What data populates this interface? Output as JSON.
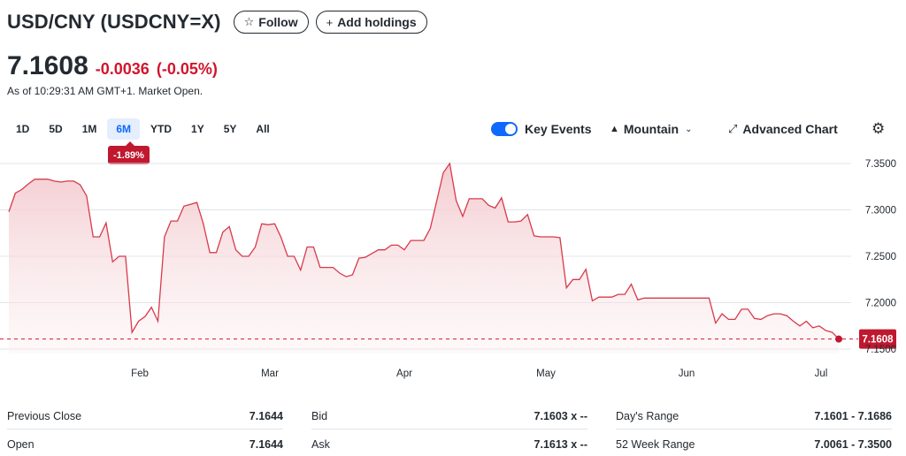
{
  "header": {
    "title": "USD/CNY (USDCNY=X)",
    "follow_label": "Follow",
    "add_holdings_label": "Add holdings"
  },
  "quote": {
    "price": "7.1608",
    "change": "-0.0036",
    "change_pct": "(-0.05%)",
    "as_of": "As of 10:29:31 AM GMT+1. Market Open."
  },
  "range_tabs": [
    {
      "label": "1D",
      "active": false
    },
    {
      "label": "5D",
      "active": false
    },
    {
      "label": "1M",
      "active": false
    },
    {
      "label": "6M",
      "active": true
    },
    {
      "label": "YTD",
      "active": false
    },
    {
      "label": "1Y",
      "active": false
    },
    {
      "label": "5Y",
      "active": false
    },
    {
      "label": "All",
      "active": false
    }
  ],
  "range_badge": "-1.89%",
  "tools": {
    "key_events_label": "Key Events",
    "key_events_on": true,
    "chart_type_label": "Mountain",
    "advanced_chart_label": "Advanced Chart"
  },
  "colors": {
    "line": "#d83a4a",
    "fill_top": "#f6d6d9",
    "down": "#d0162c",
    "accent": "#0f69ff"
  },
  "chart_data": {
    "type": "area",
    "series": [
      {
        "values": [
          7.298,
          7.318,
          7.322,
          7.328,
          7.333,
          7.333,
          7.333,
          7.331,
          7.33,
          7.331,
          7.331,
          7.327,
          7.315,
          7.271,
          7.271,
          7.286,
          7.244,
          7.25,
          7.25,
          7.168,
          7.18,
          7.185,
          7.195,
          7.18,
          7.271,
          7.288,
          7.288,
          7.304,
          7.306,
          7.308,
          7.285,
          7.254,
          7.254,
          7.276,
          7.282,
          7.257,
          7.25,
          7.25,
          7.26,
          7.285,
          7.284,
          7.285,
          7.27,
          7.25,
          7.25,
          7.235,
          7.26,
          7.26,
          7.238,
          7.238,
          7.238,
          7.232,
          7.228,
          7.23,
          7.248,
          7.249,
          7.253,
          7.257,
          7.257,
          7.262,
          7.262,
          7.257,
          7.267,
          7.267,
          7.267,
          7.28,
          7.31,
          7.34,
          7.35,
          7.31,
          7.293,
          7.312,
          7.312,
          7.312,
          7.305,
          7.302,
          7.313,
          7.287,
          7.287,
          7.288,
          7.295,
          7.272,
          7.271,
          7.271,
          7.271,
          7.27,
          7.216,
          7.225,
          7.225,
          7.236,
          7.202,
          7.206,
          7.206,
          7.206,
          7.209,
          7.209,
          7.22,
          7.203,
          7.205,
          7.205,
          7.205,
          7.205,
          7.205,
          7.205,
          7.205,
          7.205,
          7.205,
          7.205,
          7.205,
          7.178,
          7.188,
          7.182,
          7.182,
          7.193,
          7.193,
          7.183,
          7.182,
          7.186,
          7.188,
          7.188,
          7.186,
          7.18,
          7.175,
          7.18,
          7.173,
          7.175,
          7.17,
          7.168,
          7.1608
        ]
      }
    ],
    "x_ticks": [
      "Feb",
      "Mar",
      "Apr",
      "May",
      "Jun",
      "Jul"
    ],
    "y_ticks": [
      "7.3500",
      "7.3000",
      "7.2500",
      "7.2000",
      "7.1500"
    ],
    "ylim": [
      7.15,
      7.36
    ],
    "current_label": "7.1608",
    "reference_value": 7.1608,
    "grid": true
  },
  "stats": [
    {
      "label": "Previous Close",
      "value": "7.1644"
    },
    {
      "label": "Open",
      "value": "7.1644"
    },
    {
      "label": "Bid",
      "value": "7.1603 x --"
    },
    {
      "label": "Ask",
      "value": "7.1613 x --"
    },
    {
      "label": "Day's Range",
      "value": "7.1601 - 7.1686"
    },
    {
      "label": "52 Week Range",
      "value": "7.0061 - 7.3500"
    }
  ]
}
